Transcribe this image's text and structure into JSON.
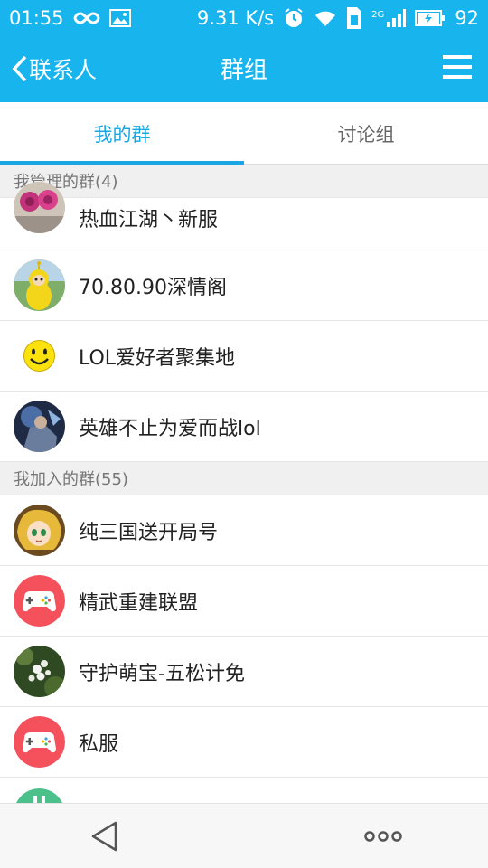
{
  "status_bar": {
    "time": "01:55",
    "speed": "9.31 K/s",
    "battery": "92",
    "network": "2G",
    "icons": [
      "infinity-icon",
      "gallery-icon",
      "alarm-icon",
      "wifi-icon",
      "sim-icon",
      "signal-icon",
      "battery-charging-icon"
    ]
  },
  "nav": {
    "back_label": "联系人",
    "title": "群组",
    "menu_icon": "hamburger-icon"
  },
  "tabs": [
    {
      "label": "我的群",
      "active": true
    },
    {
      "label": "讨论组",
      "active": false
    }
  ],
  "sections": [
    {
      "header": "我管理的群(4)",
      "groups": [
        {
          "name": "热血江湖丶新服",
          "avatar": "roses-photo-avatar"
        },
        {
          "name": "70.80.90深情阁",
          "avatar": "teletubby-avatar"
        },
        {
          "name": "LOL爱好者聚集地",
          "avatar": "smiley-face-avatar"
        },
        {
          "name": "英雄不止为爱而战lol",
          "avatar": "game-hero-avatar"
        }
      ]
    },
    {
      "header": "我加入的群(55)",
      "groups": [
        {
          "name": "纯三国送开局号",
          "avatar": "anime-girl-avatar"
        },
        {
          "name": "精武重建联盟",
          "avatar": "gamepad-avatar"
        },
        {
          "name": "守护萌宝-五松计免",
          "avatar": "flower-photo-avatar"
        },
        {
          "name": "私服",
          "avatar": "gamepad-avatar"
        }
      ]
    }
  ],
  "colors": {
    "header_blue": "#18b4ed",
    "tab_active": "#19a6e2",
    "gamepad_red": "#f4515c"
  },
  "bottom_bar": {
    "back_icon": "triangle-back-icon",
    "more_icon": "more-dots-icon"
  }
}
